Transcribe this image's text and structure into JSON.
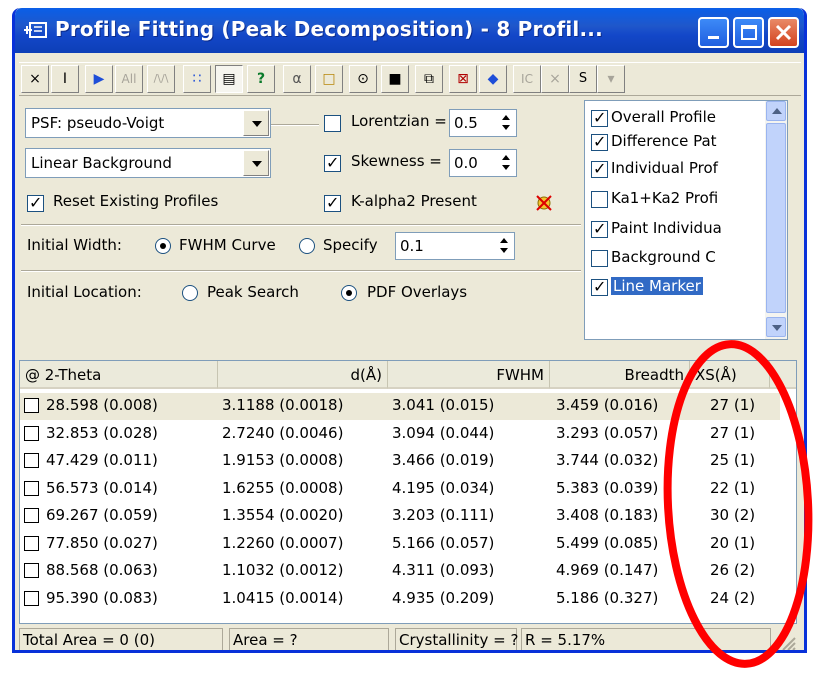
{
  "window": {
    "title": "Profile Fitting (Peak Decomposition) - 8 Profil..."
  },
  "toolbar": {
    "buttons": [
      {
        "label": "×",
        "icon": "close-x-icon"
      },
      {
        "label": "I",
        "icon": "text-cursor-icon"
      },
      {
        "label": "▶",
        "icon": "play-icon"
      },
      {
        "label": "All",
        "icon": "all-icon"
      },
      {
        "label": "/\\/\\",
        "icon": "peaks-icon"
      },
      {
        "label": "∷",
        "icon": "dots-icon"
      },
      {
        "label": "▤",
        "icon": "table-icon"
      },
      {
        "label": "?",
        "icon": "help-icon"
      },
      {
        "label": "α",
        "icon": "alpha-icon"
      },
      {
        "label": "□",
        "icon": "folder-icon"
      },
      {
        "label": "⊙",
        "icon": "printer-icon"
      },
      {
        "label": "■",
        "icon": "save-icon"
      },
      {
        "label": "⧉",
        "icon": "copy-icon"
      },
      {
        "label": "⊠",
        "icon": "exit-icon"
      },
      {
        "label": "◆",
        "icon": "marker-icon"
      },
      {
        "label": "IC",
        "icon": "ic-icon"
      },
      {
        "label": "×",
        "icon": "clear-icon"
      },
      {
        "label": "S",
        "icon": "s-icon"
      }
    ]
  },
  "settings": {
    "psf_value": "PSF: pseudo-Voigt",
    "background_value": "Linear Background",
    "lorentzian_label": "Lorentzian =",
    "lorentzian_value": "0.5",
    "skewness_label": "Skewness =",
    "skewness_value": "0.0",
    "reset_label": "Reset Existing Profiles",
    "kalpha_label": "K-alpha2 Present",
    "initial_width_label": "Initial Width:",
    "fwhm_curve_label": "FWHM Curve",
    "specify_label": "Specify",
    "specify_value": "0.1",
    "initial_location_label": "Initial Location:",
    "peak_search_label": "Peak Search",
    "pdf_overlays_label": "PDF Overlays",
    "options": [
      {
        "label": "Overall Profile",
        "checked": true
      },
      {
        "label": "Difference Pat",
        "checked": true
      },
      {
        "label": "Individual Prof",
        "checked": true
      },
      {
        "label": "Ka1+Ka2 Profi",
        "checked": false
      },
      {
        "label": "Paint Individua",
        "checked": true
      },
      {
        "label": "Background C",
        "checked": false
      },
      {
        "label": "Line Marker",
        "checked": true
      }
    ]
  },
  "table": {
    "headers": [
      "@ 2-Theta",
      "d(Å)",
      "FWHM",
      "Breadth",
      "XS(Å)"
    ],
    "rows": [
      [
        "28.598 (0.008)",
        "3.1188 (0.0018)",
        "3.041 (0.015)",
        "3.459 (0.016)",
        "27 (1)"
      ],
      [
        "32.853 (0.028)",
        "2.7240 (0.0046)",
        "3.094 (0.044)",
        "3.293 (0.057)",
        "27 (1)"
      ],
      [
        "47.429 (0.011)",
        "1.9153 (0.0008)",
        "3.466 (0.019)",
        "3.744 (0.032)",
        "25 (1)"
      ],
      [
        "56.573 (0.014)",
        "1.6255 (0.0008)",
        "4.195 (0.034)",
        "5.383 (0.039)",
        "22 (1)"
      ],
      [
        "69.267 (0.059)",
        "1.3554 (0.0020)",
        "3.203 (0.111)",
        "3.408 (0.183)",
        "30 (2)"
      ],
      [
        "77.850 (0.027)",
        "1.2260 (0.0007)",
        "5.166 (0.057)",
        "5.499 (0.085)",
        "20 (1)"
      ],
      [
        "88.568 (0.063)",
        "1.1032 (0.0012)",
        "4.311 (0.093)",
        "4.969 (0.147)",
        "26 (2)"
      ],
      [
        "95.390 (0.083)",
        "1.0415 (0.0014)",
        "4.935 (0.209)",
        "5.186 (0.327)",
        "24 (2)"
      ]
    ]
  },
  "status": {
    "total_area": "Total Area = 0 (0)",
    "area": "Area = ?",
    "crystallinity": "Crystallinity = ?",
    "r_value": "R = 5.17%"
  },
  "colors": {
    "title_blue": "#0a5fe8",
    "annotation_red": "#ff0000",
    "selection_blue": "#316ac5"
  }
}
